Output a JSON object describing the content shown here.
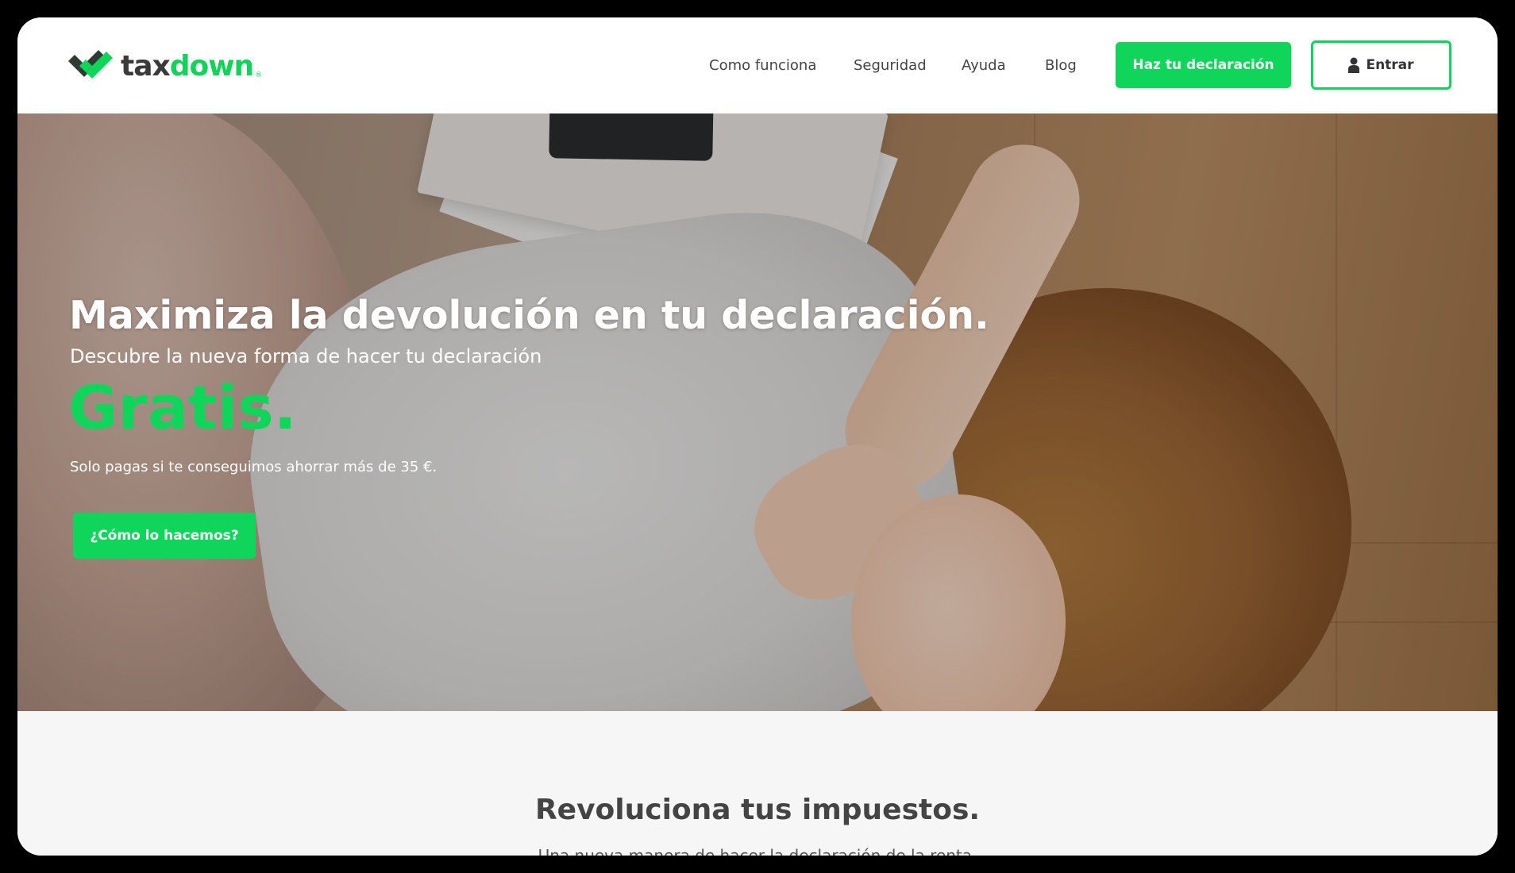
{
  "brand": {
    "name_part1": "tax",
    "name_part2": "down",
    "reg_mark": "®",
    "accent_color": "#0fd65a",
    "dark_color": "#3a3a3a"
  },
  "nav": {
    "links": [
      "Como funciona",
      "Seguridad",
      "Ayuda",
      "Blog"
    ],
    "primary_cta": "Haz tu declaración",
    "login": "Entrar"
  },
  "hero": {
    "title": "Maximiza la devolución en tu declaración.",
    "subtitle": "Descubre la nueva forma de hacer tu declaración",
    "highlight": "Gratis.",
    "note": "Solo pagas si te conseguimos ahorrar más de 35 €.",
    "cta": "¿Cómo lo hacemos?"
  },
  "section": {
    "title": "Revoluciona tus impuestos.",
    "subtitle": "Una nueva manera de hacer la declaración de la renta."
  },
  "icons": {
    "logo": "checkmark-logo-icon",
    "user": "user-icon"
  }
}
